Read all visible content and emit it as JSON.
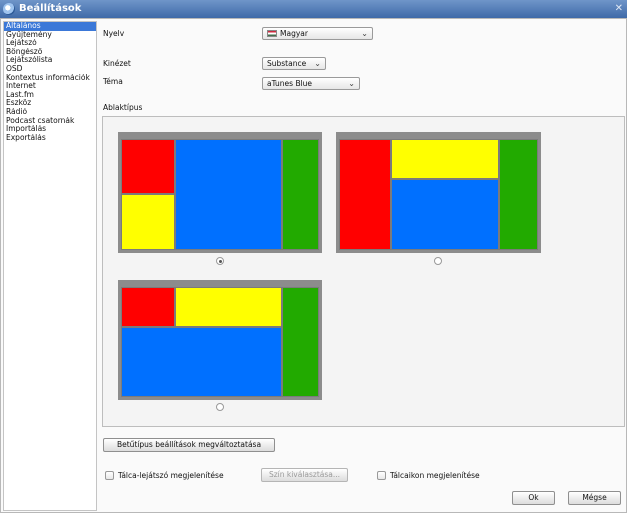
{
  "window": {
    "title": "Beállítások",
    "close": "✕"
  },
  "sidebar": {
    "items": [
      {
        "label": "Általános",
        "selected": true
      },
      {
        "label": "Gyűjtemény"
      },
      {
        "label": "Lejátszó"
      },
      {
        "label": "Böngésző"
      },
      {
        "label": "Lejátszólista"
      },
      {
        "label": "OSD"
      },
      {
        "label": "Kontextus információk"
      },
      {
        "label": "Internet"
      },
      {
        "label": "Last.fm"
      },
      {
        "label": "Eszköz"
      },
      {
        "label": "Rádió"
      },
      {
        "label": "Podcast csatornák"
      },
      {
        "label": "Importálás"
      },
      {
        "label": "Exportálás"
      }
    ]
  },
  "language": {
    "label": "Nyelv",
    "value": "Magyar",
    "flag_icon": "hungary-flag-icon"
  },
  "look": {
    "label": "Kinézet",
    "value": "Substance"
  },
  "theme": {
    "label": "Téma",
    "value": "aTunes Blue"
  },
  "window_type": {
    "label": "Ablaktípus",
    "selected_index": 0
  },
  "colors": {
    "red": "#ff0000",
    "blue": "#0070ff",
    "yellow": "#ffff00",
    "green": "#22aa00",
    "titlebar": "#3f6aa8"
  },
  "font_button": "Betűtípus beállítások megváltoztatása",
  "tray_player": {
    "label": "Tálca-lejátszó megjelenítése",
    "checked": false
  },
  "color_button": "Szín kiválasztása...",
  "tray_icons": {
    "label": "Tálcaikon megjelenítése",
    "checked": false
  },
  "ok": "Ok",
  "cancel": "Mégse"
}
